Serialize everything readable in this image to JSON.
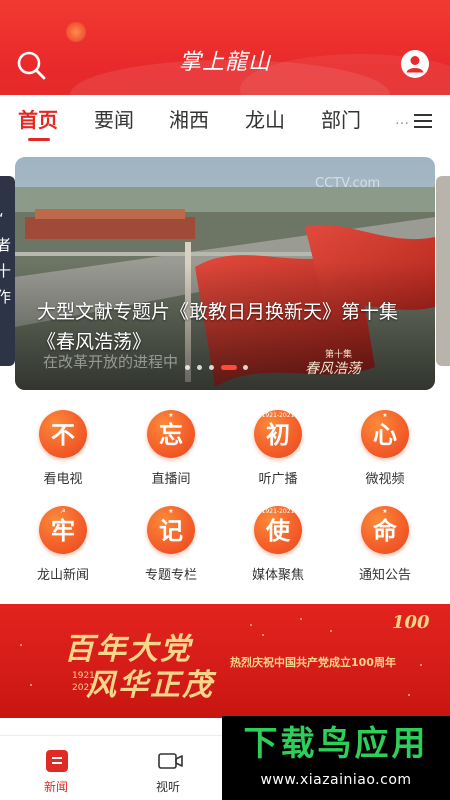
{
  "header": {
    "logo_text": "掌上龍山",
    "search_icon": "search-icon",
    "user_icon": "user-icon"
  },
  "tabs": [
    {
      "label": "首页",
      "active": true
    },
    {
      "label": "要闻"
    },
    {
      "label": "湘西"
    },
    {
      "label": "龙山"
    },
    {
      "label": "部门"
    },
    {
      "label": "…"
    }
  ],
  "tabs_more_icon": "menu-icon",
  "banner": {
    "caption": "大型文献专题片《敢教日月换新天》第十集《春风浩荡》",
    "video_overlay": "在改革开放的进程中",
    "episode_badge": "第十集",
    "episode_title": "春风浩荡",
    "channel_logo": "CCTV.com",
    "prev_slide_text": [
      "“",
      "者",
      "十",
      "作"
    ],
    "dots": 5,
    "active_dot": 3
  },
  "grid": [
    {
      "char": "不",
      "label": "看电视",
      "sup": ""
    },
    {
      "char": "忘",
      "label": "直播间",
      "sup": "★"
    },
    {
      "char": "初",
      "label": "听广播",
      "sup": "1921-2021"
    },
    {
      "char": "心",
      "label": "微视频",
      "sup": "★"
    },
    {
      "char": "牢",
      "label": "龙山新闻",
      "sup": "☭"
    },
    {
      "char": "记",
      "label": "专题专栏",
      "sup": "★"
    },
    {
      "char": "使",
      "label": "媒体聚焦",
      "sup": "1921-2021"
    },
    {
      "char": "命",
      "label": "通知公告",
      "sup": "★"
    }
  ],
  "promo": {
    "title_line1": "百年大党",
    "title_line2": "风华正茂",
    "years_top": "1921",
    "years_bottom": "2021",
    "slogan": "热烈庆祝中国共产党成立100周年",
    "badge_number": "100"
  },
  "bottom_nav": [
    {
      "label": "新闻",
      "icon": "news-icon",
      "active": true
    },
    {
      "label": "视听",
      "icon": "video-icon"
    }
  ],
  "watermark": {
    "title": "下载鸟应用",
    "url": "www.xiazainiao.com"
  },
  "colors": {
    "brand_red": "#e9292b",
    "active_tab": "#e02a26",
    "icon_orange": "#f4602a",
    "gold": "#f7d58b",
    "watermark_green": "#2ecf58"
  }
}
